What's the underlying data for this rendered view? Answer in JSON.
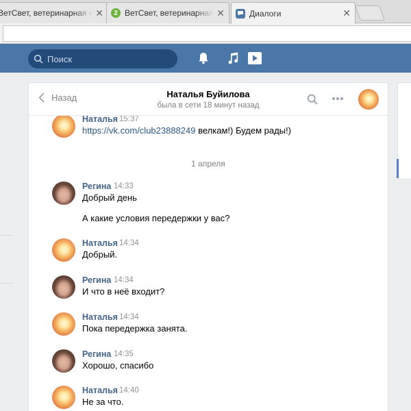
{
  "browser": {
    "tabs": [
      {
        "title": "ВетСвет, ветеринарная клиника",
        "favicon": "green-2-icon"
      },
      {
        "title": "ВетСвет, ветеринарная клиника",
        "favicon": "green-2-icon"
      },
      {
        "title": "Диалоги",
        "favicon": "vk-dialog-icon"
      }
    ]
  },
  "header": {
    "search_placeholder": "Поиск",
    "icons": [
      "bell-icon",
      "music-note-icon",
      "play-icon"
    ],
    "accent": "#4a76a8"
  },
  "dialog": {
    "back_label": "Назад",
    "contact_name": "Наталья Буйилова",
    "status": "была в сети 18 минут назад",
    "date_separator": "1 апреля",
    "messages": [
      {
        "name": "Наталья",
        "time": "15:37",
        "lines": [
          "https://vk.com/club23888249",
          "велкам!) Будем рады!)"
        ],
        "avatar": "sunset-avatar"
      },
      {
        "name": "Регина",
        "time": "14:33",
        "lines": [
          "Добрый день",
          "А какие условия передержки у вас?"
        ],
        "avatar": "girl-avatar"
      },
      {
        "name": "Наталья",
        "time": "14:34",
        "lines": [
          "Добрый."
        ],
        "avatar": "sunset-avatar"
      },
      {
        "name": "Регина",
        "time": "14:34",
        "lines": [
          "И что в неё входит?"
        ],
        "avatar": "girl-avatar"
      },
      {
        "name": "Наталья",
        "time": "14:34",
        "lines": [
          "Пока передержка занята."
        ],
        "avatar": "sunset-avatar"
      },
      {
        "name": "Регина",
        "time": "14:35",
        "lines": [
          "Хорошо, спасибо"
        ],
        "avatar": "girl-avatar"
      },
      {
        "name": "Наталья",
        "time": "14:40",
        "lines": [
          "Не за что."
        ],
        "avatar": "sunset-avatar"
      }
    ]
  }
}
